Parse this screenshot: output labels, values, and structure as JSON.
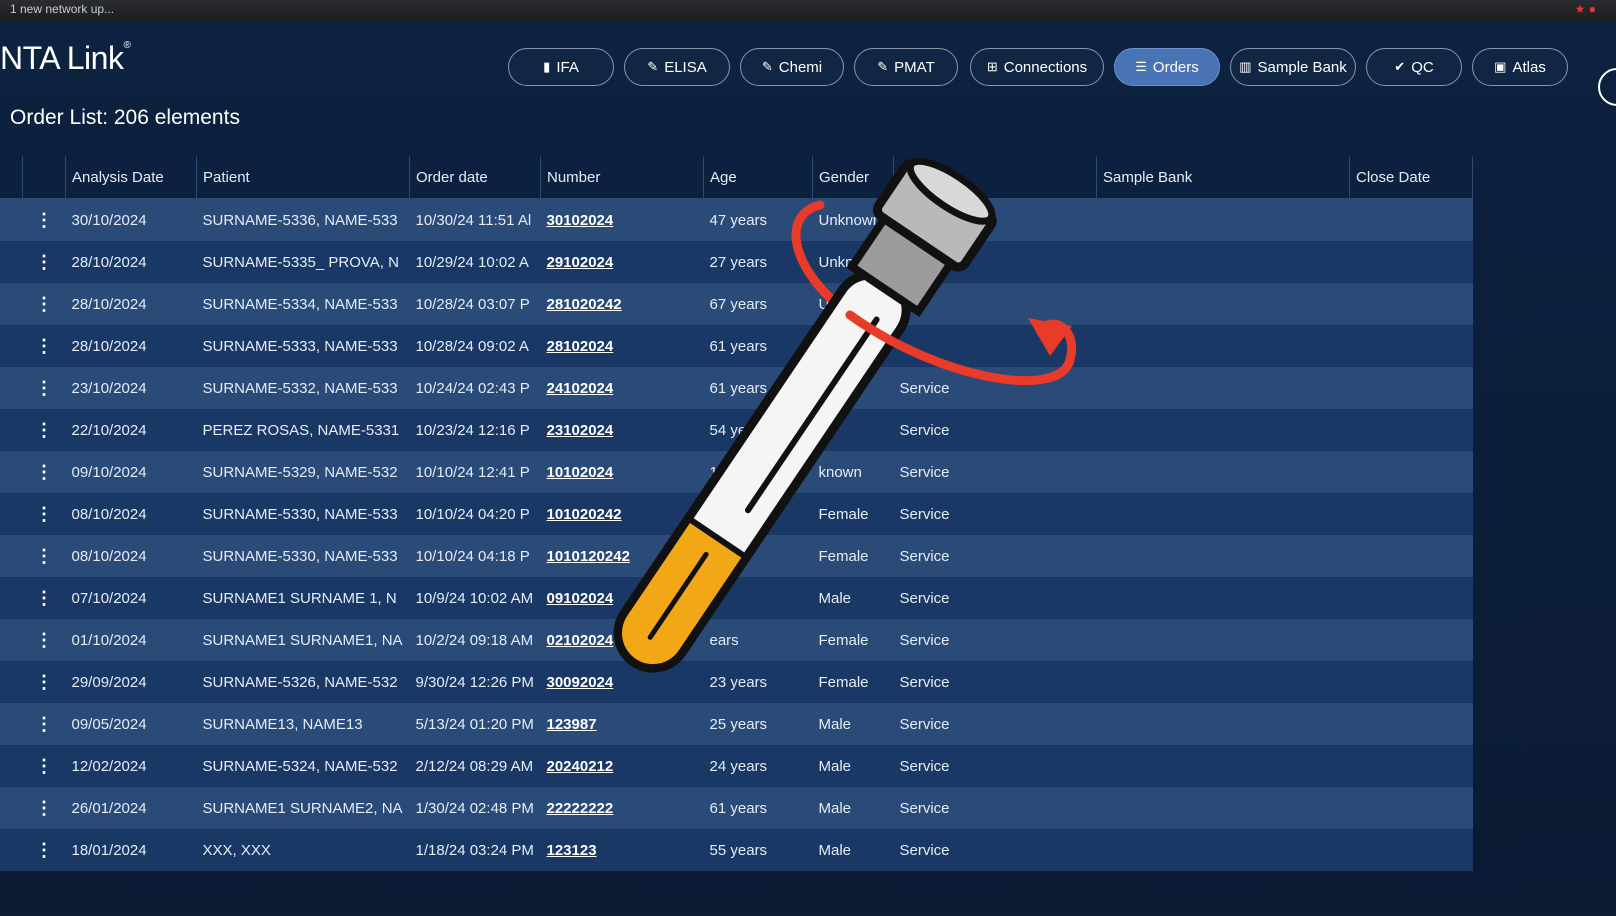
{
  "browser": {
    "tab_text": "1 new network up...",
    "icons_right": "★ ●"
  },
  "app": {
    "brand": "NTA Link",
    "brand_mark": "®"
  },
  "nav": [
    {
      "label": "IFA",
      "icon": "bars-icon",
      "glyph": "▮",
      "active": false
    },
    {
      "label": "ELISA",
      "icon": "pencil-icon",
      "glyph": "✎",
      "active": false
    },
    {
      "label": "Chemi",
      "icon": "pencil-icon",
      "glyph": "✎",
      "active": false
    },
    {
      "label": "PMAT",
      "icon": "pencil-icon",
      "glyph": "✎",
      "active": false
    },
    {
      "label": "Connections",
      "icon": "sitemap-icon",
      "glyph": "⊞",
      "active": false
    },
    {
      "label": "Orders",
      "icon": "list-icon",
      "glyph": "☰",
      "active": true
    },
    {
      "label": "Sample Bank",
      "icon": "columns-icon",
      "glyph": "▥",
      "active": false
    },
    {
      "label": "QC",
      "icon": "check-circle-icon",
      "glyph": "✔",
      "active": false
    },
    {
      "label": "Atlas",
      "icon": "image-icon",
      "glyph": "▣",
      "active": false
    }
  ],
  "page": {
    "title": "Order List: 206 elements"
  },
  "table": {
    "columns": [
      "Analysis Date",
      "Patient",
      "Order date",
      "Number",
      "Age",
      "Gender",
      "",
      "Sample Bank",
      "Close Date"
    ],
    "rows": [
      {
        "date": "30/10/2024",
        "patient": "SURNAME-5336, NAME-533",
        "order": "10/30/24 11:51 Al",
        "number": "30102024",
        "age": "47 years",
        "gender": "Unknown",
        "type": ""
      },
      {
        "date": "28/10/2024",
        "patient": "SURNAME-5335_ PROVA, N",
        "order": "10/29/24 10:02 A",
        "number": "29102024",
        "age": "27 years",
        "gender": "Unkno",
        "type": ""
      },
      {
        "date": "28/10/2024",
        "patient": "SURNAME-5334, NAME-533",
        "order": "10/28/24 03:07 P",
        "number": "281020242",
        "age": "67 years",
        "gender": "Un",
        "type": "ce"
      },
      {
        "date": "28/10/2024",
        "patient": "SURNAME-5333, NAME-533",
        "order": "10/28/24 09:02 A",
        "number": "28102024",
        "age": "61 years",
        "gender": "",
        "type": ""
      },
      {
        "date": "23/10/2024",
        "patient": "SURNAME-5332, NAME-533",
        "order": "10/24/24 02:43 P",
        "number": "24102024",
        "age": "61 years",
        "gender": "",
        "type": "Service"
      },
      {
        "date": "22/10/2024",
        "patient": "PEREZ ROSAS, NAME-5331",
        "order": "10/23/24 12:16 P",
        "number": "23102024",
        "age": "54 yea",
        "gender": "e",
        "type": "Service"
      },
      {
        "date": "09/10/2024",
        "patient": "SURNAME-5329, NAME-532",
        "order": "10/10/24 12:41 P",
        "number": "10102024",
        "age": "10",
        "gender": "known",
        "type": "Service"
      },
      {
        "date": "08/10/2024",
        "patient": "SURNAME-5330, NAME-533",
        "order": "10/10/24 04:20 P",
        "number": "101020242",
        "age": "",
        "gender": "Female",
        "type": "Service"
      },
      {
        "date": "08/10/2024",
        "patient": "SURNAME-5330, NAME-533",
        "order": "10/10/24 04:18 P",
        "number": "1010120242",
        "age": "",
        "gender": "Female",
        "type": "Service"
      },
      {
        "date": "07/10/2024",
        "patient": "SURNAME1 SURNAME 1, N",
        "order": "10/9/24 10:02 AM",
        "number": "09102024",
        "age": "s",
        "gender": "Male",
        "type": "Service"
      },
      {
        "date": "01/10/2024",
        "patient": "SURNAME1 SURNAME1, NA",
        "order": "10/2/24 09:18 AM",
        "number": "02102024",
        "age": "ears",
        "gender": "Female",
        "type": "Service"
      },
      {
        "date": "29/09/2024",
        "patient": "SURNAME-5326, NAME-532",
        "order": "9/30/24 12:26 PM",
        "number": "30092024",
        "age": "23 years",
        "gender": "Female",
        "type": "Service"
      },
      {
        "date": "09/05/2024",
        "patient": "SURNAME13, NAME13",
        "order": "5/13/24 01:20 PM",
        "number": "123987",
        "age": "25 years",
        "gender": "Male",
        "type": "Service"
      },
      {
        "date": "12/02/2024",
        "patient": "SURNAME-5324, NAME-532",
        "order": "2/12/24 08:29 AM",
        "number": "20240212",
        "age": "24 years",
        "gender": "Male",
        "type": "Service"
      },
      {
        "date": "26/01/2024",
        "patient": "SURNAME1 SURNAME2, NA",
        "order": "1/30/24 02:48 PM",
        "number": "22222222",
        "age": "61 years",
        "gender": "Male",
        "type": "Service"
      },
      {
        "date": "18/01/2024",
        "patient": "XXX, XXX",
        "order": "1/18/24 03:24 PM",
        "number": "123123",
        "age": "55 years",
        "gender": "Male",
        "type": "Service"
      }
    ]
  },
  "overlay": {
    "tube_cap_color": "#b9b9b9",
    "tube_liquid_color": "#f2a716",
    "arrow_color": "#e83b2a"
  }
}
